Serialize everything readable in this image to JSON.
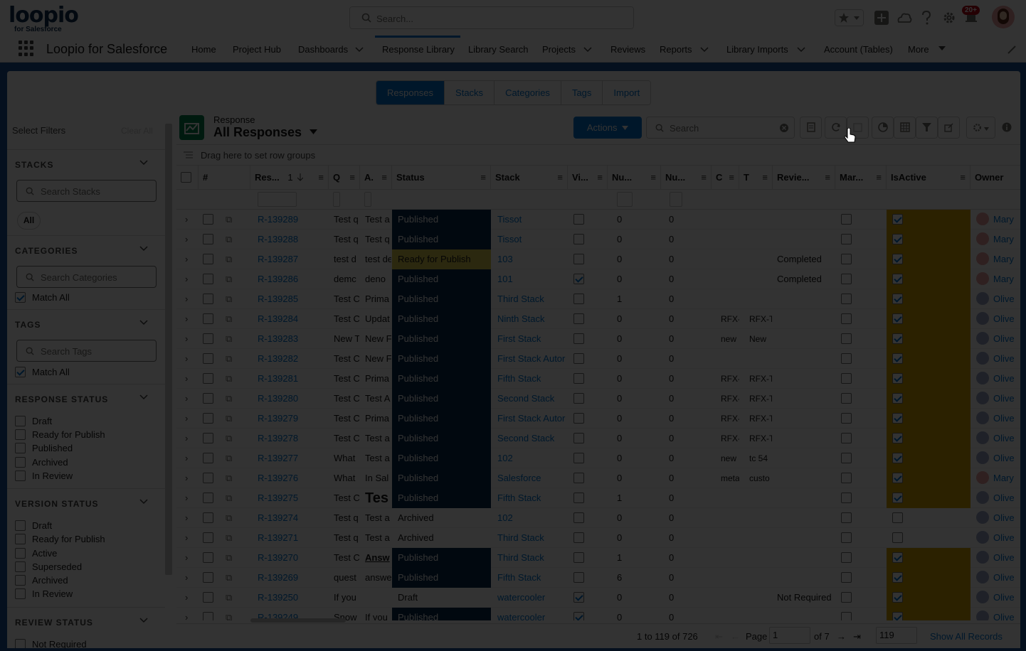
{
  "brand": {
    "logo_text": "loopio",
    "logo_sub": "for Salesforce"
  },
  "global_search": {
    "placeholder": "Search..."
  },
  "notifications": {
    "badge": "20+"
  },
  "nav": {
    "app_name": "Loopio for Salesforce",
    "items": [
      {
        "label": "Home"
      },
      {
        "label": "Project Hub"
      },
      {
        "label": "Dashboards"
      },
      {
        "label": "Response Library"
      },
      {
        "label": "Library Search"
      },
      {
        "label": "Projects"
      },
      {
        "label": "Reviews"
      },
      {
        "label": "Reports"
      },
      {
        "label": "Library Imports"
      },
      {
        "label": "Account (Tables)"
      },
      {
        "label": "More"
      }
    ],
    "active": "Response Library"
  },
  "subtabs": [
    {
      "label": "Responses",
      "active": true
    },
    {
      "label": "Stacks"
    },
    {
      "label": "Categories"
    },
    {
      "label": "Tags"
    },
    {
      "label": "Import"
    }
  ],
  "filters": {
    "title": "Select Filters",
    "clear_all": "Clear All",
    "stacks": {
      "header": "STACKS",
      "placeholder": "Search Stacks",
      "pill": "All"
    },
    "categories": {
      "header": "CATEGORIES",
      "placeholder": "Search Categories",
      "match_all": "Match All"
    },
    "tags": {
      "header": "TAGS",
      "placeholder": "Search Tags",
      "match_all": "Match All"
    },
    "response_status": {
      "header": "RESPONSE STATUS",
      "options": [
        "Draft",
        "Ready for Publish",
        "Published",
        "Archived",
        "In Review"
      ]
    },
    "version_status": {
      "header": "VERSION STATUS",
      "options": [
        "Draft",
        "Ready for Publish",
        "Active",
        "Superseded",
        "Archived",
        "In Review"
      ]
    },
    "review_status": {
      "header": "REVIEW STATUS",
      "options": [
        "Not Required"
      ]
    }
  },
  "grid": {
    "object_label": "Response",
    "list_name": "All Responses",
    "actions_label": "Actions",
    "search_placeholder": "Search",
    "row_group_hint": "Drag here to set row groups",
    "columns": {
      "num": "#",
      "res": "Res...",
      "sort_idx": "1",
      "q": "Q",
      "a": "A.",
      "status": "Status",
      "stack": "Stack",
      "vi": "Vi...",
      "nu1": "Nu...",
      "nu2": "Nu...",
      "c": "C",
      "t": "T",
      "review": "Revie...",
      "mar": "Mar...",
      "isactive": "IsActive",
      "owner": "Owner"
    },
    "rows": [
      {
        "id": "R-139289",
        "q": "Test q",
        "a": "Test a",
        "status": "Published",
        "stack": "Tissot",
        "vi": false,
        "nu1": "0",
        "nu2": "0",
        "c": "",
        "t": "",
        "review": "",
        "active": true,
        "owner": "Mary"
      },
      {
        "id": "R-139288",
        "q": "Test q",
        "a": "Test q",
        "status": "Published",
        "stack": "Tissot",
        "vi": false,
        "nu1": "0",
        "nu2": "0",
        "c": "",
        "t": "",
        "review": "",
        "active": true,
        "owner": "Mary"
      },
      {
        "id": "R-139287",
        "q": "test d",
        "a": "test de",
        "status": "Ready for Publish",
        "stack": "103",
        "vi": false,
        "nu1": "0",
        "nu2": "0",
        "c": "",
        "t": "",
        "review": "Completed",
        "active": true,
        "owner": "Mary"
      },
      {
        "id": "R-139286",
        "q": "demc",
        "a": "deno",
        "status": "Published",
        "stack": "101",
        "vi": true,
        "nu1": "0",
        "nu2": "0",
        "c": "",
        "t": "",
        "review": "Completed",
        "active": true,
        "owner": "Mary"
      },
      {
        "id": "R-139285",
        "q": "Test C",
        "a": "Prima",
        "status": "Published",
        "stack": "Third Stack",
        "vi": false,
        "nu1": "1",
        "nu2": "0",
        "c": "",
        "t": "",
        "review": "",
        "active": true,
        "owner": "Olive"
      },
      {
        "id": "R-139284",
        "q": "Test C",
        "a": "Updat",
        "status": "Published",
        "stack": "Ninth Stack",
        "vi": false,
        "nu1": "0",
        "nu2": "0",
        "c": "RFX-",
        "t": "RFX-T",
        "review": "",
        "active": true,
        "owner": "Olive"
      },
      {
        "id": "R-139283",
        "q": "New T",
        "a": "New F",
        "status": "Published",
        "stack": "First Stack",
        "vi": false,
        "nu1": "0",
        "nu2": "0",
        "c": "new",
        "t": "New",
        "review": "",
        "active": true,
        "owner": "Olive"
      },
      {
        "id": "R-139282",
        "q": "Test C",
        "a": "New F",
        "status": "Published",
        "stack": "First Stack Autor",
        "vi": false,
        "nu1": "0",
        "nu2": "0",
        "c": "",
        "t": "",
        "review": "",
        "active": true,
        "owner": "Olive"
      },
      {
        "id": "R-139281",
        "q": "Test C",
        "a": "Prima",
        "status": "Published",
        "stack": "Fifth Stack",
        "vi": false,
        "nu1": "0",
        "nu2": "0",
        "c": "RFX-",
        "t": "RFX-T",
        "review": "",
        "active": true,
        "owner": "Olive"
      },
      {
        "id": "R-139280",
        "q": "Test C",
        "a": "Test A",
        "status": "Published",
        "stack": "Second Stack",
        "vi": false,
        "nu1": "0",
        "nu2": "0",
        "c": "RFX-",
        "t": "RFX-T",
        "review": "",
        "active": true,
        "owner": "Olive"
      },
      {
        "id": "R-139279",
        "q": "Test C",
        "a": "Prima",
        "status": "Published",
        "stack": "First Stack Autor",
        "vi": false,
        "nu1": "0",
        "nu2": "0",
        "c": "RFX-",
        "t": "RFX-T",
        "review": "",
        "active": true,
        "owner": "Olive"
      },
      {
        "id": "R-139278",
        "q": "Test C",
        "a": "Test a",
        "status": "Published",
        "stack": "Second Stack",
        "vi": false,
        "nu1": "0",
        "nu2": "0",
        "c": "RFX-",
        "t": "RFX-T",
        "review": "",
        "active": true,
        "owner": "Olive"
      },
      {
        "id": "R-139277",
        "q": "What",
        "a": "Test a",
        "status": "Published",
        "stack": "102",
        "vi": false,
        "nu1": "0",
        "nu2": "0",
        "c": "new",
        "t": "tc 54",
        "review": "",
        "active": true,
        "owner": "Olive"
      },
      {
        "id": "R-139276",
        "q": "What",
        "a": "In Sal",
        "status": "Published",
        "stack": "Salesforce",
        "vi": false,
        "nu1": "0",
        "nu2": "0",
        "c": "meta",
        "t": "custo",
        "review": "",
        "active": true,
        "owner": "Mary"
      },
      {
        "id": "R-139275",
        "q": "Test C",
        "a": "Tes",
        "status": "Published",
        "stack": "Fifth Stack",
        "vi": false,
        "nu1": "1",
        "nu2": "0",
        "c": "",
        "t": "",
        "review": "",
        "active": true,
        "owner": "Olive"
      },
      {
        "id": "R-139274",
        "q": "Test q",
        "a": "Test a",
        "status": "Archived",
        "stack": "102",
        "vi": false,
        "nu1": "0",
        "nu2": "0",
        "c": "",
        "t": "",
        "review": "",
        "active": false,
        "owner": "Olive"
      },
      {
        "id": "R-139271",
        "q": "Test q",
        "a": "Test a",
        "status": "Archived",
        "stack": "Third Stack",
        "vi": false,
        "nu1": "0",
        "nu2": "0",
        "c": "",
        "t": "",
        "review": "",
        "active": false,
        "owner": "Olive"
      },
      {
        "id": "R-139270",
        "q": "Test C",
        "a": "Answ",
        "status": "Published",
        "stack": "Third Stack",
        "vi": false,
        "nu1": "1",
        "nu2": "0",
        "c": "",
        "t": "",
        "review": "",
        "active": true,
        "owner": "Olive"
      },
      {
        "id": "R-139269",
        "q": "quest",
        "a": "answe",
        "status": "Published",
        "stack": "Fifth Stack",
        "vi": false,
        "nu1": "6",
        "nu2": "0",
        "c": "",
        "t": "",
        "review": "",
        "active": true,
        "owner": "Olive"
      },
      {
        "id": "R-139250",
        "q": "If you",
        "a": "",
        "status": "Draft",
        "stack": "watercooler",
        "vi": true,
        "nu1": "0",
        "nu2": "0",
        "c": "",
        "t": "",
        "review": "Not Required",
        "active": true,
        "owner": "Olive"
      },
      {
        "id": "R-139249",
        "q": "Snow",
        "a": "If you",
        "status": "Published",
        "stack": "watercooler",
        "vi": true,
        "nu1": "0",
        "nu2": "0",
        "c": "",
        "t": "",
        "review": "",
        "active": true,
        "owner": "Olive"
      }
    ],
    "footer": {
      "range": "1 to 119 of 726",
      "page_label": "Page",
      "page_value": "1",
      "of_label": "of 7",
      "page_size": "119",
      "show_all": "Show All Records"
    }
  },
  "colors": {
    "accent": "#0176d3",
    "published": "#06284d",
    "ready": "#d8c84a",
    "isactive": "#d8a600",
    "band": "#1b5297",
    "overlay": "rgba(0,0,0,0.8)"
  }
}
